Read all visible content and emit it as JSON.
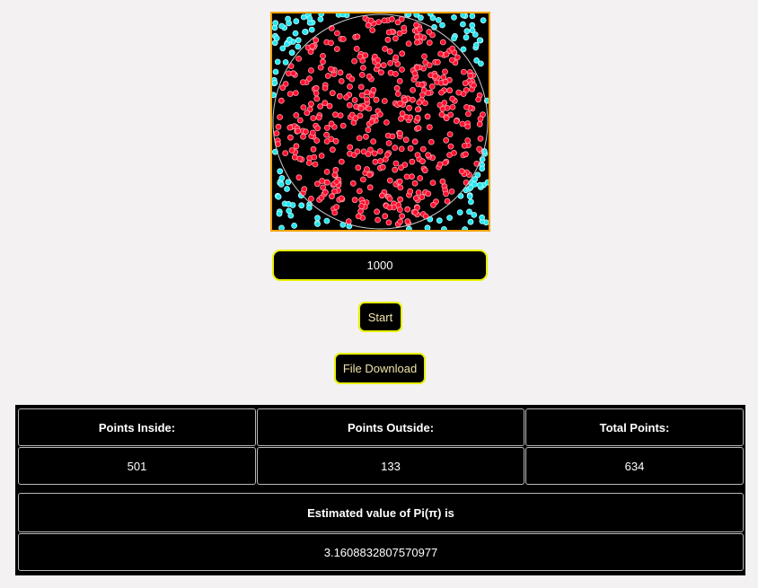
{
  "simulation": {
    "colors": {
      "inside_point": "#ff1030",
      "outside_point": "#22e6f0",
      "circle": "#c8c8c8",
      "canvas_border": "#f5a300",
      "canvas_background": "#000000"
    },
    "point_count_shown": 634
  },
  "controls": {
    "points_input_value": "1000",
    "start_label": "Start",
    "download_label": "File Download"
  },
  "stats": {
    "inside_label": "Points Inside:",
    "outside_label": "Points Outside:",
    "total_label": "Total Points:",
    "inside_value": "501",
    "outside_value": "133",
    "total_value": "634",
    "estimate_label": "Estimated value of Pi(π) is",
    "estimate_value": "3.1608832807570977"
  }
}
